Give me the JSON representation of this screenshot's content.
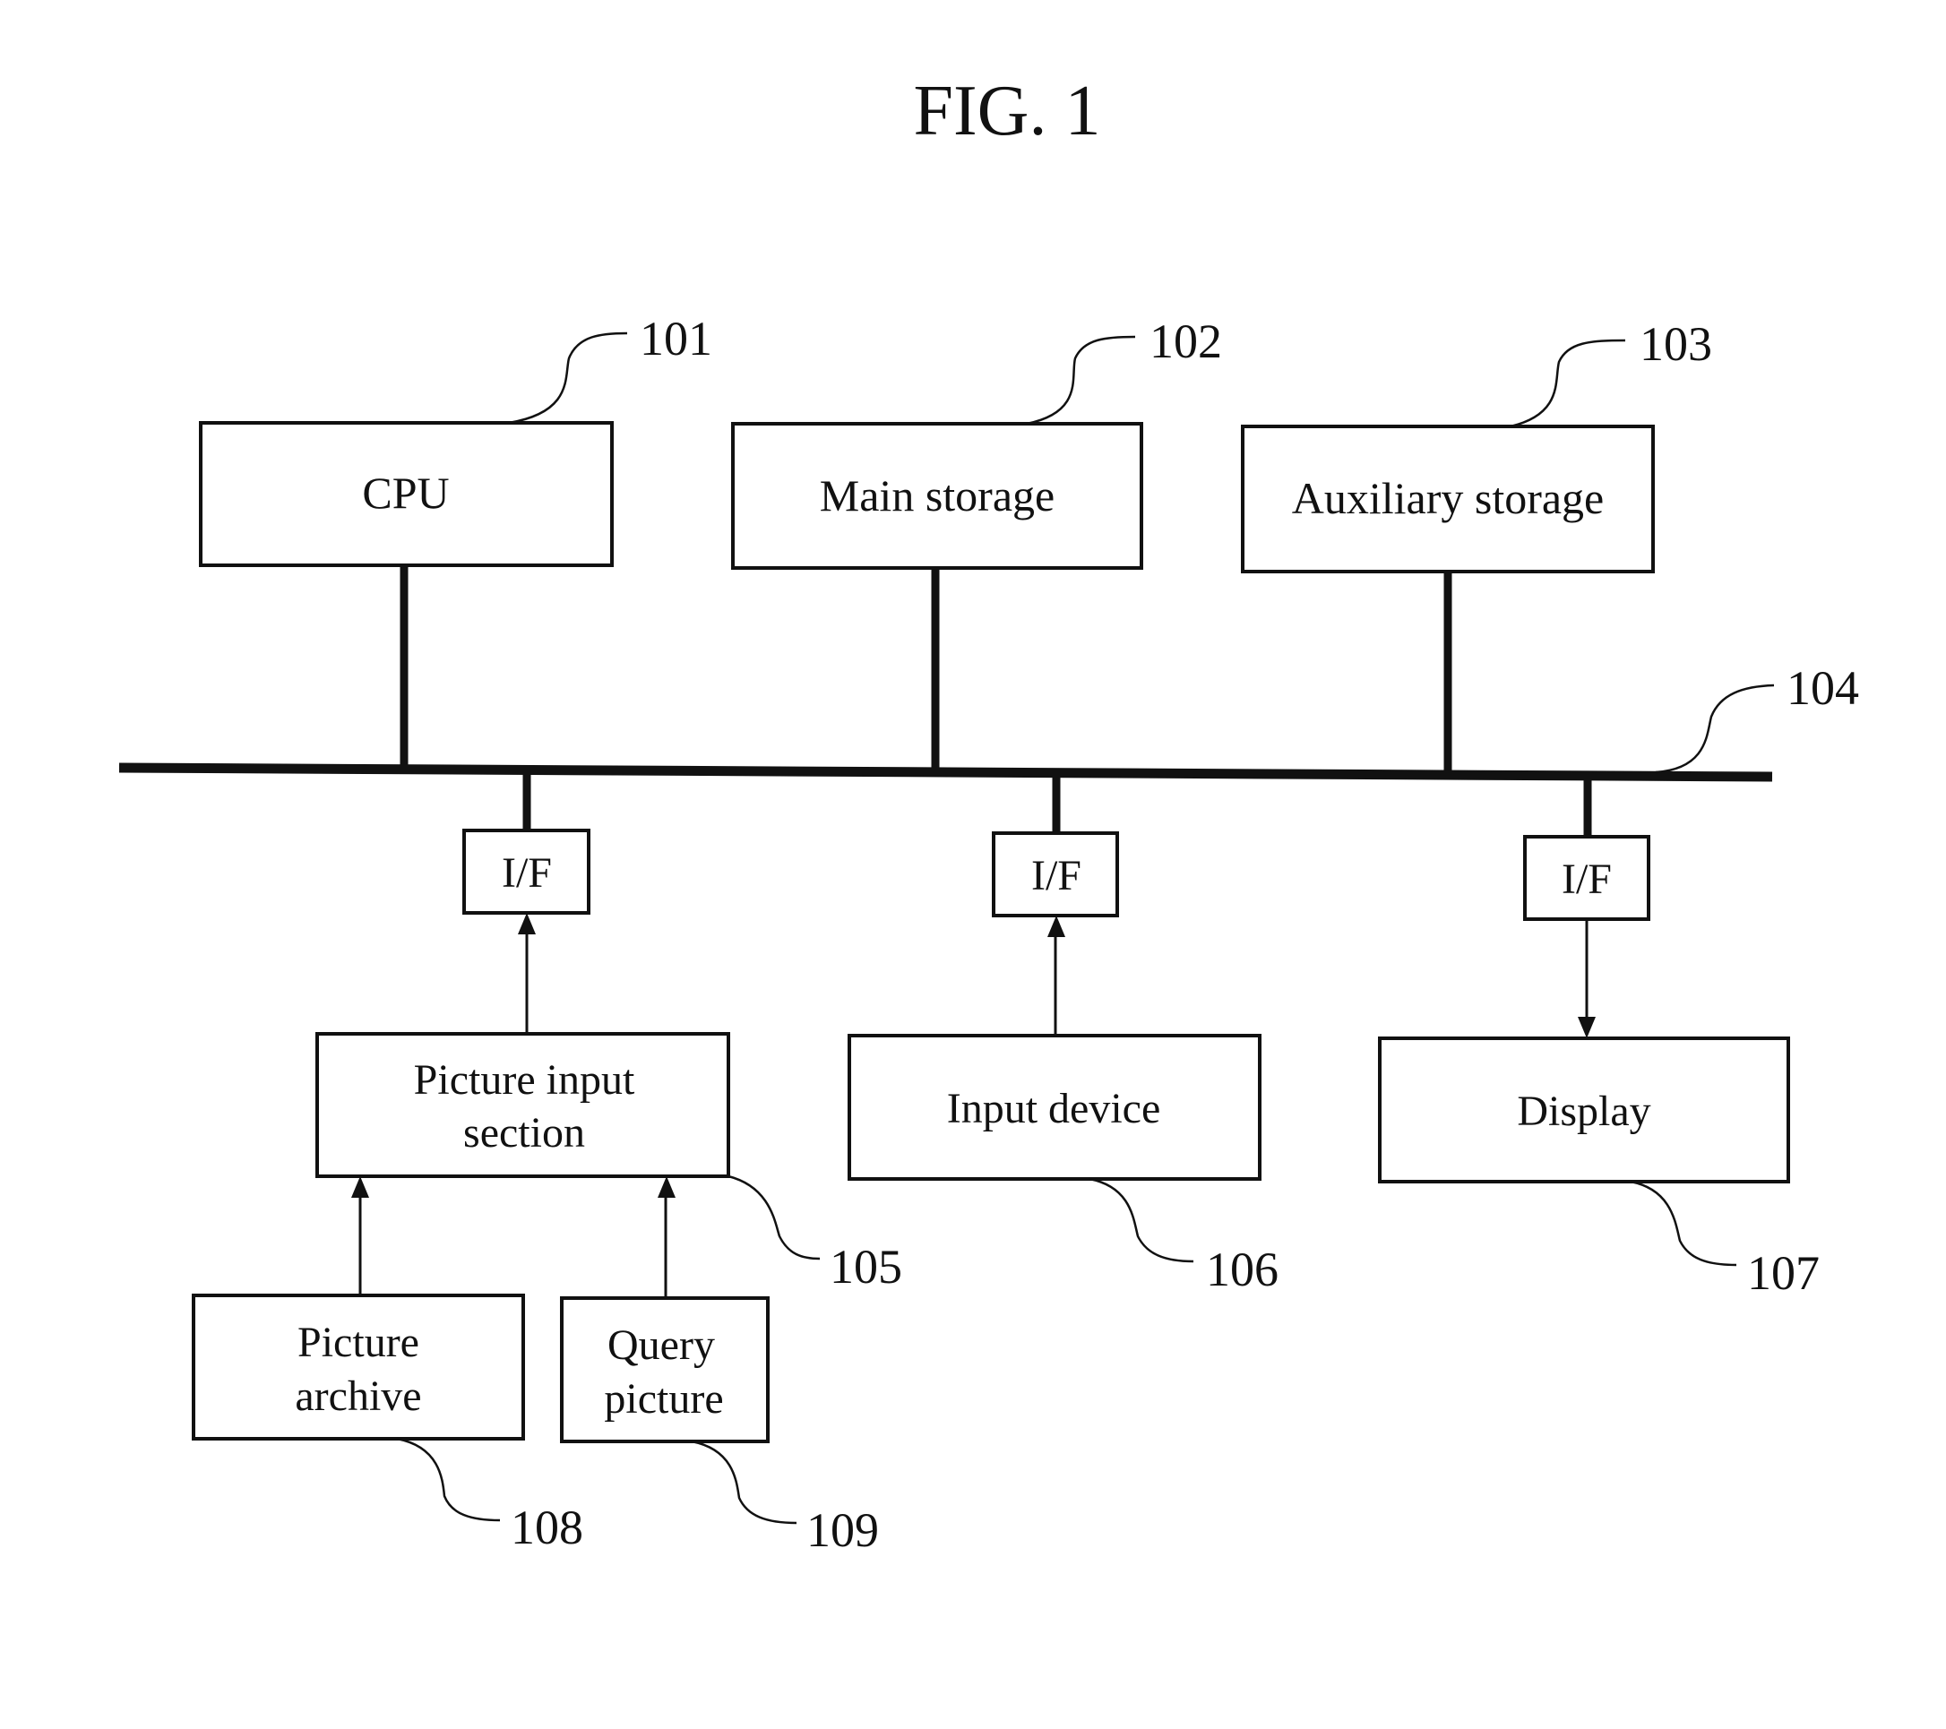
{
  "figure": {
    "title": "FIG. 1",
    "components": [
      {
        "id": "cpu",
        "ref": "101",
        "lines": [
          "CPU"
        ]
      },
      {
        "id": "main-storage",
        "ref": "102",
        "lines": [
          "Main storage"
        ]
      },
      {
        "id": "auxiliary-storage",
        "ref": "103",
        "lines": [
          "Auxiliary storage"
        ]
      },
      {
        "id": "picture-input-section",
        "ref": "105",
        "lines": [
          "Picture input",
          "section"
        ]
      },
      {
        "id": "input-device",
        "ref": "106",
        "lines": [
          "Input device"
        ]
      },
      {
        "id": "display",
        "ref": "107",
        "lines": [
          "Display"
        ]
      },
      {
        "id": "picture-archive",
        "ref": "108",
        "lines": [
          "Picture",
          "archive"
        ]
      },
      {
        "id": "query-picture",
        "ref": "109",
        "lines": [
          "Query",
          "picture"
        ]
      }
    ],
    "bus": {
      "ref": "104"
    },
    "interfaces": [
      {
        "id": "if-picture-input",
        "label": "I/F"
      },
      {
        "id": "if-input-device",
        "label": "I/F"
      },
      {
        "id": "if-display",
        "label": "I/F"
      }
    ],
    "connections": [
      {
        "from": "cpu",
        "to": "bus",
        "type": "bus-link"
      },
      {
        "from": "main-storage",
        "to": "bus",
        "type": "bus-link"
      },
      {
        "from": "auxiliary-storage",
        "to": "bus",
        "type": "bus-link"
      },
      {
        "from": "bus",
        "to": "if-picture-input",
        "type": "bus-link"
      },
      {
        "from": "bus",
        "to": "if-input-device",
        "type": "bus-link"
      },
      {
        "from": "bus",
        "to": "if-display",
        "type": "bus-link"
      },
      {
        "from": "picture-input-section",
        "to": "if-picture-input",
        "type": "arrow"
      },
      {
        "from": "input-device",
        "to": "if-input-device",
        "type": "arrow"
      },
      {
        "from": "if-display",
        "to": "display",
        "type": "arrow"
      },
      {
        "from": "picture-archive",
        "to": "picture-input-section",
        "type": "arrow"
      },
      {
        "from": "query-picture",
        "to": "picture-input-section",
        "type": "arrow"
      }
    ]
  }
}
